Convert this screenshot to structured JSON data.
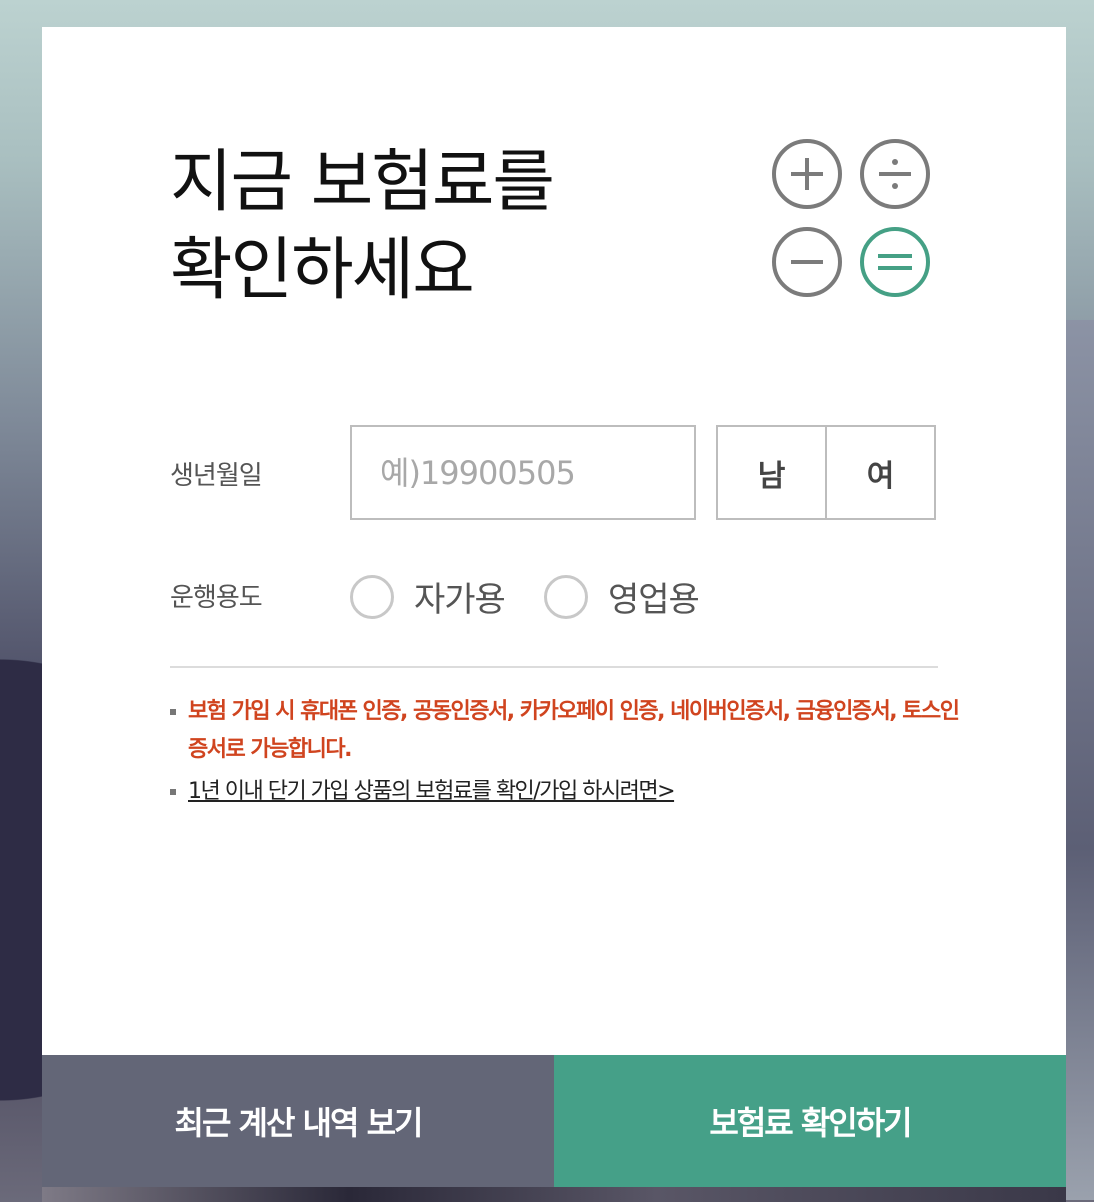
{
  "title": {
    "line1": "지금 보험료를",
    "line2": "확인하세요"
  },
  "icons": {
    "calculator": [
      "plus-icon",
      "divide-icon",
      "minus-icon",
      "equals-icon"
    ],
    "accent_color": "#45a085",
    "neutral_color": "#7b7b7b"
  },
  "form": {
    "birth": {
      "label": "생년월일",
      "placeholder": "예)19900505",
      "value": ""
    },
    "gender": {
      "male": "남",
      "female": "여"
    },
    "usage": {
      "label": "운행용도",
      "option_private": "자가용",
      "option_business": "영업용"
    }
  },
  "notes": {
    "auth": "보험 가입 시 휴대폰 인증, 공동인증서, 카카오페이 인증, 네이버인증서, 금융인증서, 토스인증서로 가능합니다.",
    "short_term_link": "1년 이내 단기 가입 상품의 보험료를 확인/가입 하시려면>"
  },
  "buttons": {
    "history": "최근 계산 내역 보기",
    "check": "보험료 확인하기"
  },
  "colors": {
    "history_button": "#636677",
    "check_button": "#45a088",
    "notice_red": "#d0441f"
  }
}
